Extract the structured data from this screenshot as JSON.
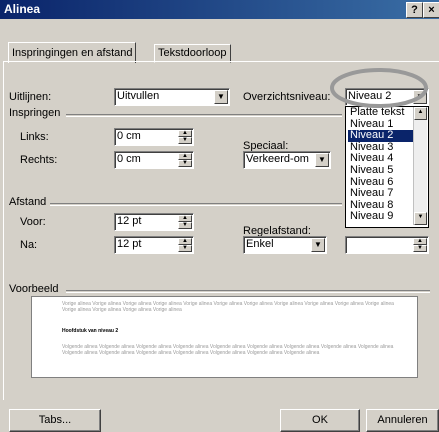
{
  "window": {
    "title": "Alinea",
    "help_label": "?",
    "close_label": "×"
  },
  "tabs": [
    {
      "label": "Inspringingen en afstand"
    },
    {
      "label": "Tekstdoorloop"
    }
  ],
  "fields": {
    "uitlijnen_label": "Uitlijnen:",
    "uitlijnen_value": "Uitvullen",
    "overzichtsniveau_label": "Overzichtsniveau:",
    "overzichtsniveau_value": "Niveau 2",
    "inspringen_label": "Inspringen",
    "links_label": "Links:",
    "links_value": "0 cm",
    "rechts_label": "Rechts:",
    "rechts_value": "0 cm",
    "speciaal_label": "Speciaal:",
    "speciaal_value": "Verkeerd-om",
    "afstand_label": "Afstand",
    "voor_label": "Voor:",
    "voor_value": "12 pt",
    "na_label": "Na:",
    "na_value": "12 pt",
    "regelafstand_label": "Regelafstand:",
    "regelafstand_value": "Enkel"
  },
  "dropdown_options": [
    "Platte tekst",
    "Niveau 1",
    "Niveau 2",
    "Niveau 3",
    "Niveau 4",
    "Niveau 5",
    "Niveau 6",
    "Niveau 7",
    "Niveau 8",
    "Niveau 9"
  ],
  "dropdown_selected_index": 2,
  "preview": {
    "label": "Voorbeeld",
    "prev_text": "Vorige alinea Vorige alinea Vorige alinea Vorige alinea Vorige alinea Vorige alinea Vorige alinea Vorige alinea Vorige alinea Vorige alinea Vorige alinea Vorige alinea Vorige alinea Vorige alinea Vorige alinea",
    "heading_text": "Hoofdstuk van niveau 2",
    "next_text": "Volgende alinea Volgende alinea Volgende alinea Volgende alinea Volgende alinea Volgende alinea Volgende alinea Volgende alinea Volgende alinea Volgende alinea Volgende alinea Volgende alinea Volgende alinea Volgende alinea Volgende alinea Volgende alinea"
  },
  "buttons": {
    "tabs": "Tabs...",
    "ok": "OK",
    "cancel": "Annuleren"
  },
  "colors": {
    "title_bar": "#0a246a",
    "selection": "#0a246a",
    "highlight_circle": "#999999",
    "dialog": "#d4d0c8"
  }
}
